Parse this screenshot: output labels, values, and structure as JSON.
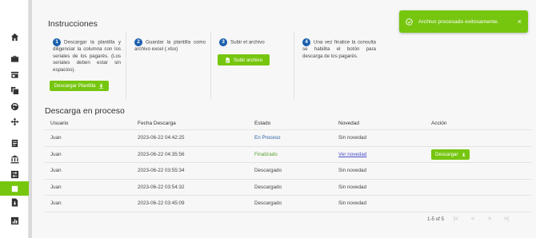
{
  "instructions": {
    "title": "Instrucciones",
    "steps": [
      {
        "num": "1",
        "text": "Descargar la plantilla y diligenciar la columna con los seriales de los pagarés. (Los seriales deben estar sin espacios)."
      },
      {
        "num": "2",
        "text": "Guardar la plantilla como archivo excel (.xlsx)"
      },
      {
        "num": "3",
        "text": "Subir el archivo"
      },
      {
        "num": "4",
        "text": "Una vez finalice la consulta se habilita el botón para descarga de los pagarés."
      }
    ],
    "download_template_label": "Descargar Plantilla",
    "upload_label": "Subir archivo"
  },
  "process": {
    "title": "Descarga en proceso",
    "columns": [
      "Usuario",
      "Fecha Descarga",
      "Estado",
      "Novedad",
      "Acción"
    ],
    "rows": [
      {
        "user": "Juan",
        "date": "2023-06-22 04:42:25",
        "state": "En Proceso",
        "novelty": "Sin novedad",
        "action": ""
      },
      {
        "user": "Juan",
        "date": "2023-06-22 04:35:56",
        "state": "Finalizado",
        "novelty": "Ver novedad",
        "action": "Descargar"
      },
      {
        "user": "Juan",
        "date": "2023-06-22 03:55:34",
        "state": "Descargado",
        "novelty": "Sin novedad",
        "action": ""
      },
      {
        "user": "Juan",
        "date": "2023-06-22 03:54:32",
        "state": "Descargado",
        "novelty": "Sin novedad",
        "action": ""
      },
      {
        "user": "Juan",
        "date": "2023-06-22 03:45:09",
        "state": "Descargado",
        "novelty": "Sin novedad",
        "action": ""
      }
    ],
    "pagination": {
      "range": "1-5 of 5",
      "first": "|<",
      "prev": "<",
      "next": ">",
      "last": ">|"
    }
  },
  "toast": {
    "message": "Archivo procesado exitosamente.",
    "close": "×"
  },
  "colors": {
    "accent": "#76c60f",
    "step_badge": "#1b5fad",
    "state_blue": "#2d5fa8",
    "state_green": "#5aa02c",
    "link": "#4a4fc7"
  },
  "sidebar_icons": [
    "home-icon",
    "briefcase-icon",
    "store-icon",
    "copy-icon",
    "globe-icon",
    "move-icon",
    "document-list-icon",
    "bank-icon",
    "exchange-icon",
    "layers-icon",
    "file-download-icon",
    "bar-chart-icon"
  ]
}
